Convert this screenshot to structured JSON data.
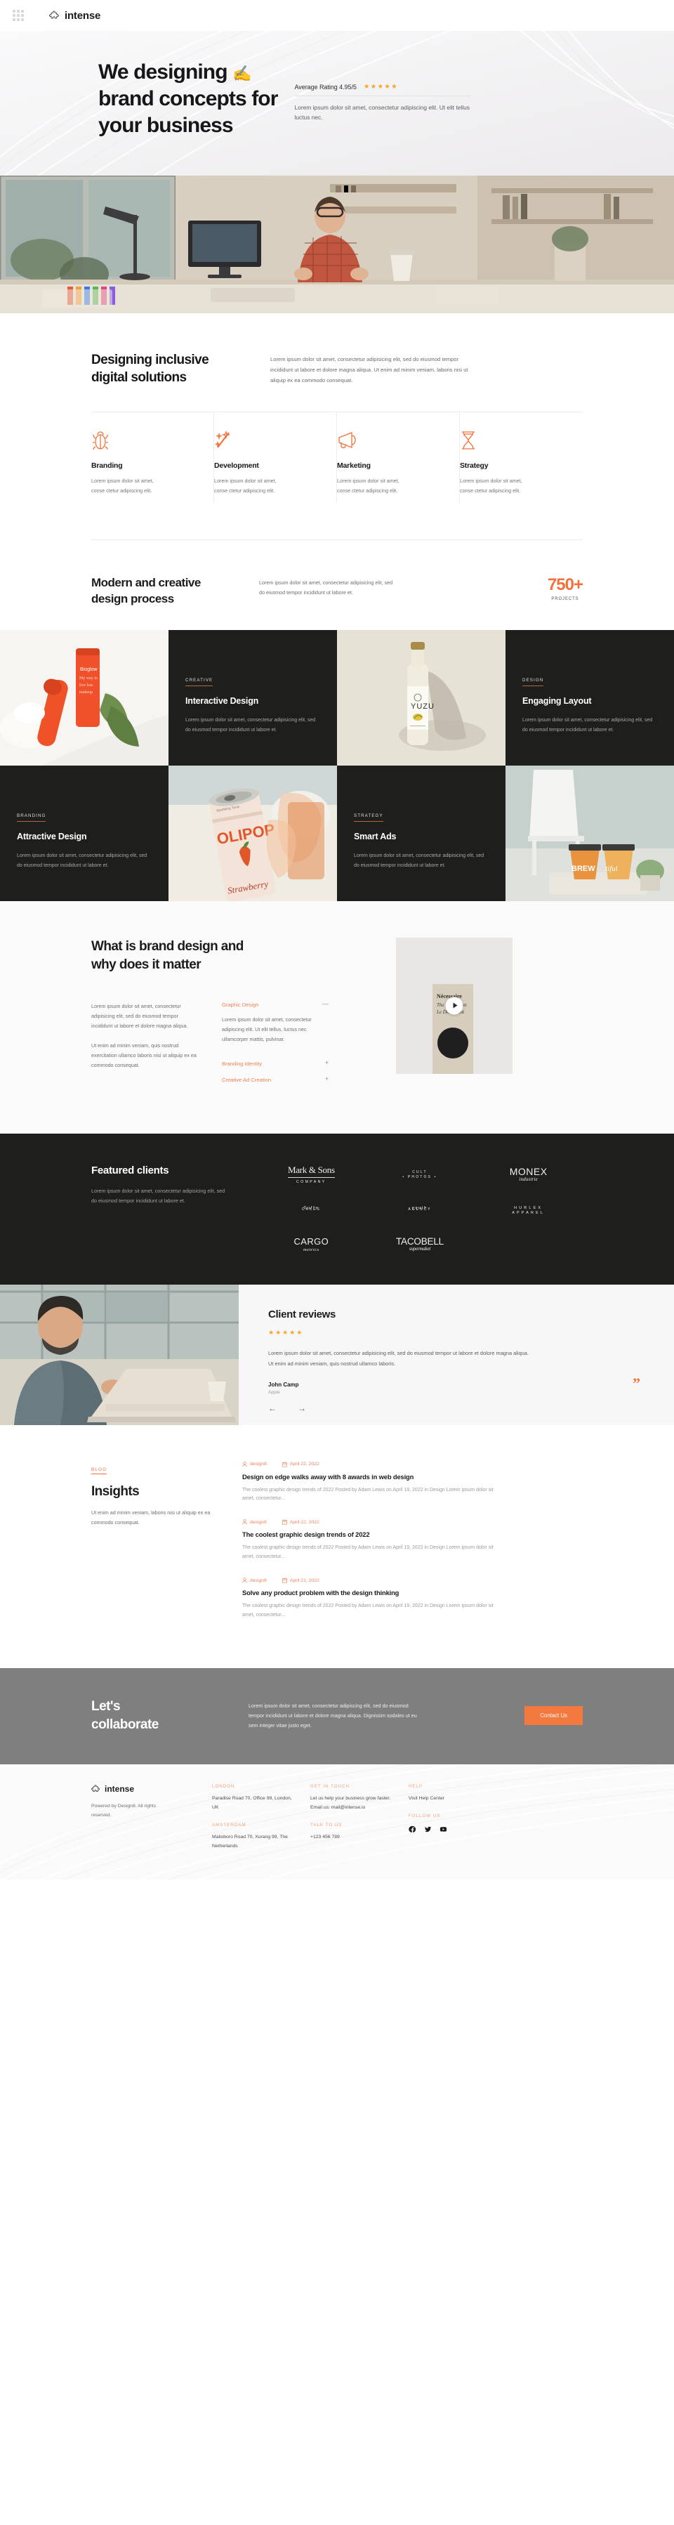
{
  "topbar": {
    "brand": "intense",
    "grid_icon": "app-grid-icon"
  },
  "hero": {
    "title_line1": "We designing",
    "title_line2": "brand concepts for",
    "title_line3": "your business",
    "pen_emoji": "✍️",
    "rating_label": "Average Rating 4.95/5",
    "stars": "★★★★★",
    "subtext": "Lorem ipsum dolor sit amet, consectetur adipiscing elit. Ut elit tellus luctus nec."
  },
  "services": {
    "heading_line1": "Designing inclusive",
    "heading_line2": "digital solutions",
    "body": "Lorem ipsum dolor sit amet, consectetur adipisicing elit, sed do eiusmod tempor incididunt ut labore et dolore magna aliqua. Ut enim ad minim veniam,  laboris nisi ut aliquip ex ea commodo consequat.",
    "items": [
      {
        "icon": "bug-icon",
        "name": "Branding",
        "text": "Lorem ipsum dolor sit amet, conse ctetur adipiscing elit."
      },
      {
        "icon": "magic-wand-icon",
        "name": "Development",
        "text": "Lorem ipsum dolor sit amet, conse ctetur adipiscing elit."
      },
      {
        "icon": "megaphone-icon",
        "name": "Marketing",
        "text": "Lorem ipsum dolor sit amet, conse ctetur adipiscing elit."
      },
      {
        "icon": "hourglass-icon",
        "name": "Strategy",
        "text": "Lorem ipsum dolor sit amet, conse ctetur adipiscing elit."
      }
    ]
  },
  "process": {
    "title_line1": "Modern and creative",
    "title_line2": "design process",
    "text": "Lorem ipsum dolor sit amet, consectetur adipisicing elit, sed do eiusmod tempor incididunt ut labore et.",
    "stat_number": "750+",
    "stat_caption": "PROJECTS"
  },
  "portfolio": {
    "cards": [
      {
        "tag": "CREATIVE",
        "title": "Interactive Design",
        "desc": "Lorem ipsum dolor sit amet, consectetur adipisicing elit, sed do eiusmod tempor incididunt ut labore et."
      },
      {
        "tag": "DESIGN",
        "title": "Engaging Layout",
        "desc": "Lorem ipsum dolor sit amet, consectetur adipisicing elit, sed do eiusmod tempor incididunt ut labore et."
      },
      {
        "tag": "BRANDING",
        "title": "Attractive Design",
        "desc": "Lorem ipsum dolor sit amet, consectetur adipisicing elit, sed do eiusmod tempor incididunt ut labore et."
      },
      {
        "tag": "STRATEGY",
        "title": "Smart Ads",
        "desc": "Lorem ipsum dolor sit amet, consectetur adipisicing elit, sed do eiusmod tempor incididunt ut labore et."
      }
    ]
  },
  "brand_design": {
    "title_line1": "What is brand design and",
    "title_line2": "why does it matter",
    "para1": "Lorem ipsum dolor sit amet, consectetur adipisicing elit, sed do eiusmod tempor incididunt ut labore et dolore magna aliqua.",
    "para2": "Ut enim ad minim veniam, quis nostrud exercitation ullamco laboris nisi ut aliquip ex ea commodo consequat.",
    "accordion": [
      {
        "label": "Graphic Design",
        "sign": "—",
        "body": "Lorem ipsum dolor sit amet, consectetur adipiscing elit. Ut elit tellus, luctus nec ullamcorper mattis, pulvinar."
      },
      {
        "label": "Branding Identity",
        "sign": "+"
      },
      {
        "label": "Creative Ad Creation",
        "sign": "+"
      }
    ],
    "video_label": "play-video",
    "poster_brand": "Nécessaire",
    "poster_line2": "The Deodorant",
    "poster_line3": "Le Déodorant"
  },
  "clients": {
    "title": "Featured clients",
    "text": "Lorem ipsum dolor sit amet, consectetur adipisicing elit, sed do eiusmod tempor incididunt ut labore et.",
    "logos": [
      {
        "name": "Mark & Sons",
        "sub": "COMPANY"
      },
      {
        "name": "CULT",
        "sub": "• PHOTOS •"
      },
      {
        "name": "MONEX",
        "sub": "industrie"
      },
      {
        "name": "Duffy",
        "sub": "CAKES"
      },
      {
        "name": "youth",
        "sub": "AGENCY"
      },
      {
        "name": "HURLEX",
        "sub": "APPAREL"
      },
      {
        "name": "CARGO",
        "sub": "metrics"
      },
      {
        "name": "TACOBELL",
        "sub": "supermaket"
      }
    ]
  },
  "reviews": {
    "title": "Client reviews",
    "stars": "★★★★★",
    "text": "Lorem ipsum dolor sit amet, consectetur adipisicing elit, sed do eiusmod tempor ut labore et dolore magna aliqua. Ut enim ad minim veniam, quis nostrud ullamco laboris.",
    "author": "John Camp",
    "role": "Apple",
    "quote_mark": "”",
    "prev": "←",
    "next": "→"
  },
  "insights": {
    "tag": "BLOG",
    "title": "Insights",
    "text": "Ut enim ad minim veniam,  laboris nisi ut aliquip ex ea commodo consequat.",
    "posts": [
      {
        "author": "design8",
        "date": "April 22, 2022",
        "title": "Design on edge walks away with 8 awards in web design",
        "excerpt": "The coolest graphic design trends of 2022 Posted by Adam Lewis on April 19, 2022 in Design Lorem ipsum dolor sit amet, consectetur..."
      },
      {
        "author": "design8",
        "date": "April 22, 2022",
        "title": "The coolest graphic design trends of 2022",
        "excerpt": "The coolest graphic design trends of 2022 Posted by Adam Lewis on April 19, 2022 in Design Lorem ipsum dolor sit amet, consectetur..."
      },
      {
        "author": "design8",
        "date": "April 21, 2022",
        "title": "Solve any product problem with the design thinking",
        "excerpt": "The coolest graphic design trends of 2022 Posted by Adam Lewis on April 19, 2022 in Design Lorem ipsum dolor sit amet, consectetur..."
      }
    ]
  },
  "cta": {
    "title_line1": "Let's",
    "title_line2": "collaborate",
    "text": "Lorem ipsum dolor sit amet, consectetur adipiscing elit, sed do eiusmod tempor incididunt ut labore et dolore magna aliqua. Dignissim sodales ut eu sem integer vitae justo eget.",
    "button": "Contact Us"
  },
  "footer": {
    "brand": "intense",
    "copyright": "Powered by Design8. All rights reserved.",
    "columns": [
      {
        "groups": [
          {
            "head": "LONDON",
            "body": "Paradise Road 70, Office 99, London, UK"
          },
          {
            "head": "AMSTERDAM",
            "body": "Malioboro Road 70, Xurang 99, The Netherlands"
          }
        ]
      },
      {
        "groups": [
          {
            "head": "GET IN TOUCH",
            "body": "Let us help your business grow faster. Email us: mail@intense.io"
          },
          {
            "head": "TALK TO US",
            "body": "+123 456 789"
          }
        ]
      },
      {
        "groups": [
          {
            "head": "HELP",
            "body": "Visit Help Center"
          },
          {
            "head": "FOLLOW US",
            "body": ""
          }
        ]
      }
    ],
    "socials": [
      "facebook-icon",
      "twitter-icon",
      "youtube-icon"
    ]
  },
  "colors": {
    "accent": "#f4713b",
    "dark": "#1e1e1c",
    "gray_cta": "#7f7f7f",
    "star": "#f5a623"
  }
}
